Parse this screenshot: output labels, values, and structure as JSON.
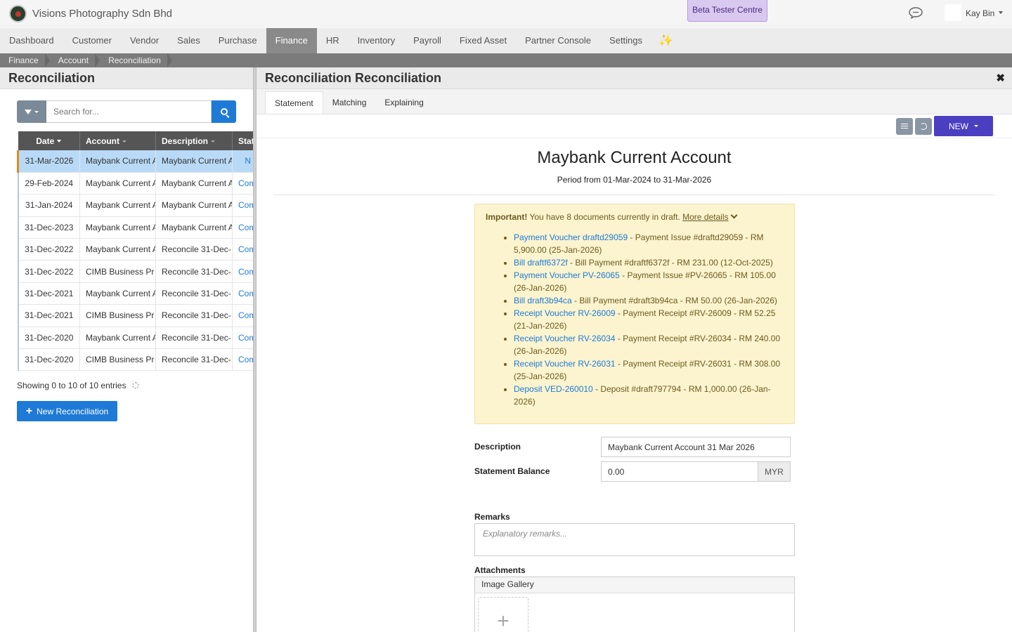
{
  "header": {
    "company": "Visions Photography Sdn Bhd",
    "beta": "Beta Tester Centre",
    "user": "Kay Bin"
  },
  "nav": [
    "Dashboard",
    "Customer",
    "Vendor",
    "Sales",
    "Purchase",
    "Finance",
    "HR",
    "Inventory",
    "Payroll",
    "Fixed Asset",
    "Partner Console",
    "Settings"
  ],
  "nav_active": "Finance",
  "nav_sparkle": "✨",
  "breadcrumb": [
    "Finance",
    "Account",
    "Reconciliation"
  ],
  "left": {
    "title": "Reconciliation",
    "search_placeholder": "Search for...",
    "columns": [
      "Date",
      "Account",
      "Description",
      "Stat"
    ],
    "rows": [
      {
        "date": "31-Mar-2026",
        "account": "Maybank Current A",
        "description": "Maybank Current A",
        "status": "N"
      },
      {
        "date": "29-Feb-2024",
        "account": "Maybank Current A",
        "description": "Maybank Current A",
        "status": "Com"
      },
      {
        "date": "31-Jan-2024",
        "account": "Maybank Current A",
        "description": "Maybank Current A",
        "status": "Com"
      },
      {
        "date": "31-Dec-2023",
        "account": "Maybank Current A",
        "description": "Maybank Current A",
        "status": "Com"
      },
      {
        "date": "31-Dec-2022",
        "account": "Maybank Current A",
        "description": "Reconcile 31-Dec-",
        "status": "Com"
      },
      {
        "date": "31-Dec-2022",
        "account": "CIMB Business Pr",
        "description": "Reconcile 31-Dec-",
        "status": "Com"
      },
      {
        "date": "31-Dec-2021",
        "account": "Maybank Current A",
        "description": "Reconcile 31-Dec-",
        "status": "Com"
      },
      {
        "date": "31-Dec-2021",
        "account": "CIMB Business Pr",
        "description": "Reconcile 31-Dec-",
        "status": "Com"
      },
      {
        "date": "31-Dec-2020",
        "account": "Maybank Current A",
        "description": "Reconcile 31-Dec-",
        "status": "Com"
      },
      {
        "date": "31-Dec-2020",
        "account": "CIMB Business Pr",
        "description": "Reconcile 31-Dec-",
        "status": "Com"
      }
    ],
    "showing": "Showing 0 to 10 of 10 entries",
    "new_button": "New Reconciliation"
  },
  "right": {
    "title": "Reconciliation Reconciliation",
    "tabs": [
      "Statement",
      "Matching",
      "Explaining"
    ],
    "active_tab": "Statement",
    "new_button": "NEW",
    "account_title": "Maybank Current Account",
    "period": "Period from 01-Mar-2024 to 31-Mar-2026",
    "alert": {
      "strong": "Important!",
      "text": " You have 8 documents currently in draft. ",
      "more": "More details",
      "items": [
        {
          "link": "Payment Voucher draftd29059",
          "rest": " - Payment Issue #draftd29059 - RM 5,900.00 (25-Jan-2026)"
        },
        {
          "link": "Bill draftf6372f",
          "rest": " - Bill Payment #draftf6372f - RM 231.00 (12-Oct-2025)"
        },
        {
          "link": "Payment Voucher PV-26065",
          "rest": " - Payment Issue #PV-26065 - RM 105.00 (26-Jan-2026)"
        },
        {
          "link": "Bill draft3b94ca",
          "rest": " - Bill Payment #draft3b94ca - RM 50.00 (26-Jan-2026)"
        },
        {
          "link": "Receipt Voucher RV-26009",
          "rest": " - Payment Receipt #RV-26009 - RM 52.25 (21-Jan-2026)"
        },
        {
          "link": "Receipt Voucher RV-26034",
          "rest": " - Payment Receipt #RV-26034 - RM 240.00 (26-Jan-2026)"
        },
        {
          "link": "Receipt Voucher RV-26031",
          "rest": " - Payment Receipt #RV-26031 - RM 308.00 (25-Jan-2026)"
        },
        {
          "link": "Deposit VED-260010",
          "rest": " - Deposit #draft797794 - RM 1,000.00 (26-Jan-2026)"
        }
      ]
    },
    "form": {
      "description_label": "Description",
      "description_value": "Maybank Current Account 31 Mar 2026",
      "balance_label": "Statement Balance",
      "balance_value": "0.00",
      "currency": "MYR",
      "remarks_label": "Remarks",
      "remarks_placeholder": "Explanatory remarks...",
      "attachments_label": "Attachments",
      "gallery_label": "Image Gallery",
      "add_symbol": "+"
    }
  }
}
